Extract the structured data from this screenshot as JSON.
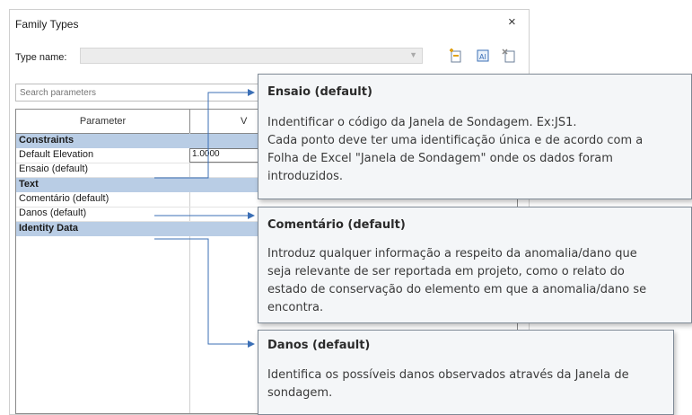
{
  "dialog": {
    "title": "Family Types",
    "close_glyph": "×",
    "type_name_label": "Type name:",
    "toolbar_icons": [
      "new-type-icon",
      "rename-type-icon",
      "delete-type-icon"
    ]
  },
  "search": {
    "placeholder": "Search parameters"
  },
  "grid": {
    "col_parameter": "Parameter",
    "col_value": "V",
    "rows": [
      {
        "kind": "group",
        "label": "Constraints"
      },
      {
        "kind": "param",
        "label": "Default Elevation",
        "value": "1.0000"
      },
      {
        "kind": "param",
        "label": "Ensaio (default)",
        "value": ""
      },
      {
        "kind": "group",
        "label": "Text"
      },
      {
        "kind": "param",
        "label": "Comentário (default)",
        "value": ""
      },
      {
        "kind": "param",
        "label": "Danos (default)",
        "value": ""
      },
      {
        "kind": "group",
        "label": "Identity Data"
      }
    ]
  },
  "callouts": [
    {
      "title": "Ensaio (default)",
      "lines": [
        "Indentificar o código da Janela de Sondagem. Ex:JS1.",
        "Cada ponto deve ter uma identificação única e de acordo com a",
        "Folha de Excel \"Janela de Sondagem\" onde os dados foram",
        "introduzidos."
      ]
    },
    {
      "title": "Comentário (default)",
      "lines": [
        "Introduz qualquer informação a respeito da anomalia/dano que",
        "seja relevante de ser reportada em projeto, como o relato do",
        "estado de conservação do elemento em que a anomalia/dano se",
        "encontra."
      ]
    },
    {
      "title": "Danos (default)",
      "lines": [
        "Identifica os possíveis danos observados através da Janela de",
        "sondagem."
      ]
    }
  ],
  "colors": {
    "group_row": "#b9cde5",
    "connector": "#3b6fb6",
    "callout_bg": "#f4f6f8"
  }
}
